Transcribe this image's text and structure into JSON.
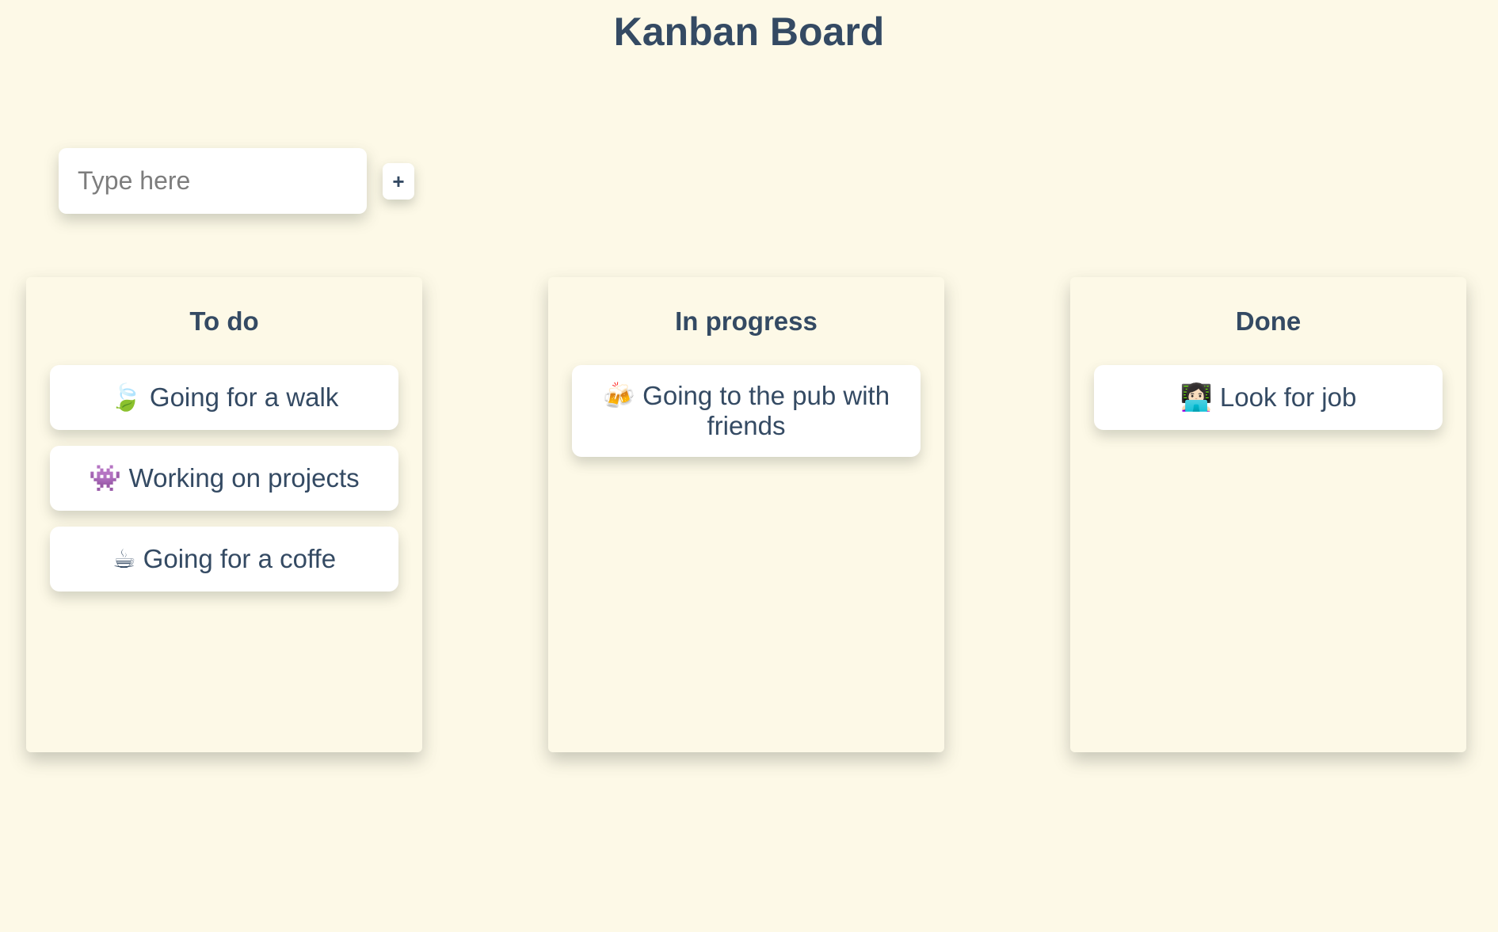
{
  "title": "Kanban Board",
  "add_form": {
    "placeholder": "Type here",
    "button_label": "+"
  },
  "columns": [
    {
      "title": "To do",
      "cards": [
        {
          "text": "🍃 Going for a walk"
        },
        {
          "text": "👾 Working on projects"
        },
        {
          "text": "☕ Going for a coffe"
        }
      ]
    },
    {
      "title": "In progress",
      "cards": [
        {
          "text": "🍻 Going to the pub with friends"
        }
      ]
    },
    {
      "title": "Done",
      "cards": [
        {
          "text": "👩🏻‍💻 Look for job"
        }
      ]
    }
  ],
  "colors": {
    "background": "#fdf9e7",
    "text": "#344a63",
    "card": "#ffffff"
  }
}
